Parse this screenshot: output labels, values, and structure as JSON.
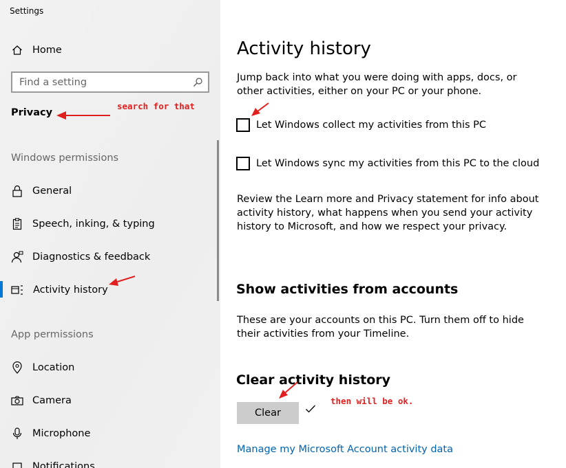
{
  "window": {
    "title": "Settings"
  },
  "sidebar": {
    "home_label": "Home",
    "search_placeholder": "Find a setting",
    "category_title": "Privacy",
    "sections": [
      {
        "header": "Windows permissions",
        "items": [
          {
            "label": "General",
            "icon": "lock-icon"
          },
          {
            "label": "Speech, inking, & typing",
            "icon": "clipboard-icon"
          },
          {
            "label": "Diagnostics & feedback",
            "icon": "person-feedback-icon"
          },
          {
            "label": "Activity history",
            "icon": "activity-history-icon",
            "active": true
          }
        ]
      },
      {
        "header": "App permissions",
        "items": [
          {
            "label": "Location",
            "icon": "location-pin-icon"
          },
          {
            "label": "Camera",
            "icon": "camera-icon"
          },
          {
            "label": "Microphone",
            "icon": "microphone-icon"
          },
          {
            "label": "Notifications",
            "icon": "notifications-icon"
          }
        ]
      }
    ]
  },
  "main": {
    "title": "Activity history",
    "intro": "Jump back into what you were doing with apps, docs, or other activities, either on your PC or your phone.",
    "checkbox_collect": {
      "label": "Let Windows collect my activities from this PC",
      "checked": false
    },
    "checkbox_sync": {
      "label": "Let Windows sync my activities from this PC to the cloud",
      "checked": false
    },
    "review_text": "Review the Learn more and Privacy statement for info about activity history, what happens when you send your activity history to Microsoft, and how we respect your privacy.",
    "accounts_title": "Show activities from accounts",
    "accounts_text": "These are your accounts on this PC. Turn them off to hide their activities from your Timeline.",
    "clear_title": "Clear activity history",
    "clear_button": "Clear",
    "manage_link": "Manage my Microsoft Account activity data"
  },
  "annotations": {
    "note_search": "search for that",
    "note_ok": "then will be ok.",
    "color": "#e0201e"
  },
  "colors": {
    "accent": "#0078d7",
    "link": "#0063b1",
    "sidebar_bg": "#f0f0f0",
    "button_bg": "#cccccc"
  }
}
